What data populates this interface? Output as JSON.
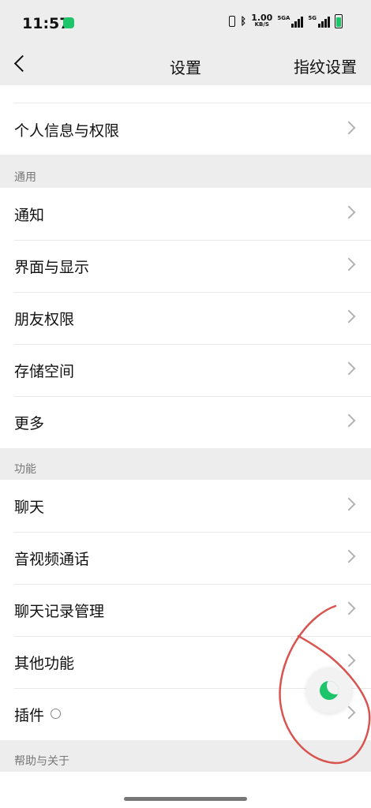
{
  "status_bar": {
    "time": "11:57",
    "net_speed_value": "1.00",
    "net_speed_unit": "KB/S",
    "sim1_label": "5GA",
    "sim2_label": "5G"
  },
  "nav": {
    "title": "设置",
    "right_action": "指纹设置"
  },
  "groups": {
    "top": {
      "items": [
        {
          "label": "个人信息与权限"
        }
      ]
    },
    "general": {
      "header": "通用",
      "items": [
        {
          "label": "通知"
        },
        {
          "label": "界面与显示"
        },
        {
          "label": "朋友权限"
        },
        {
          "label": "存储空间"
        },
        {
          "label": "更多"
        }
      ]
    },
    "features": {
      "header": "功能",
      "items": [
        {
          "label": "聊天"
        },
        {
          "label": "音视频通话"
        },
        {
          "label": "聊天记录管理"
        },
        {
          "label": "其他功能"
        },
        {
          "label": "插件"
        }
      ]
    },
    "help": {
      "header": "帮助与关于"
    }
  },
  "colors": {
    "accent": "#1ec46a",
    "background": "#ededed",
    "annotation": "#d9534f"
  },
  "icons": {
    "back": "chevron-left-icon",
    "row_arrow": "chevron-right-icon",
    "plugin": "plugin-icon",
    "floating": "moon-icon"
  }
}
